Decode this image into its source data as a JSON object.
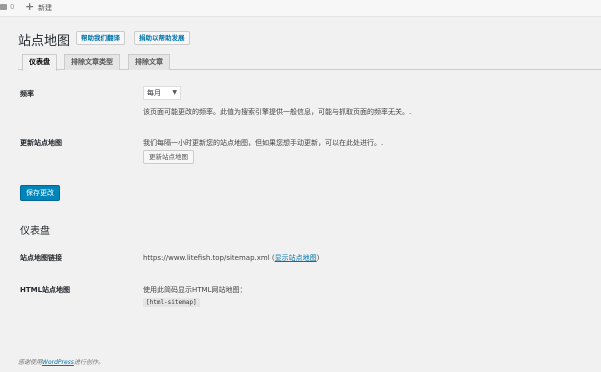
{
  "adminbar": {
    "comment_count": "0",
    "new_label": "新建"
  },
  "page": {
    "title": "站点地图",
    "help_translate_label": "帮助我们翻译",
    "donate_label": "捐助以帮助发展"
  },
  "tabs": [
    {
      "label": "仪表盘",
      "active": true
    },
    {
      "label": "排除文章类型",
      "active": false
    },
    {
      "label": "排除文章",
      "active": false
    }
  ],
  "settings": {
    "frequency_label": "频率",
    "frequency_value": "每月",
    "frequency_desc": "该页面可能更改的频率。此值为搜索引擎提供一般信息，可能与抓取页面的频率无关。.",
    "update_label": "更新站点地图",
    "update_desc": "我们每隔一小时更新您的站点地图，但如果您想手动更新，可以在此处进行。.",
    "update_button": "更新站点地图",
    "save_button": "保存更改"
  },
  "dashboard": {
    "title": "仪表盘",
    "sitemap_link_label": "站点地图链接",
    "sitemap_url": "https://www.litefish.top/sitemap.xml",
    "sitemap_show_prefix": "(",
    "sitemap_show_link": "显示站点地图",
    "sitemap_show_suffix": ")",
    "html_sitemap_label": "HTML站点地图",
    "html_sitemap_desc": "使用此简码显示HTML网站地图：",
    "shortcode": "[html-sitemap]"
  },
  "footer": {
    "prefix": "感谢使用",
    "link": "WordPress",
    "suffix": "进行创作。"
  }
}
